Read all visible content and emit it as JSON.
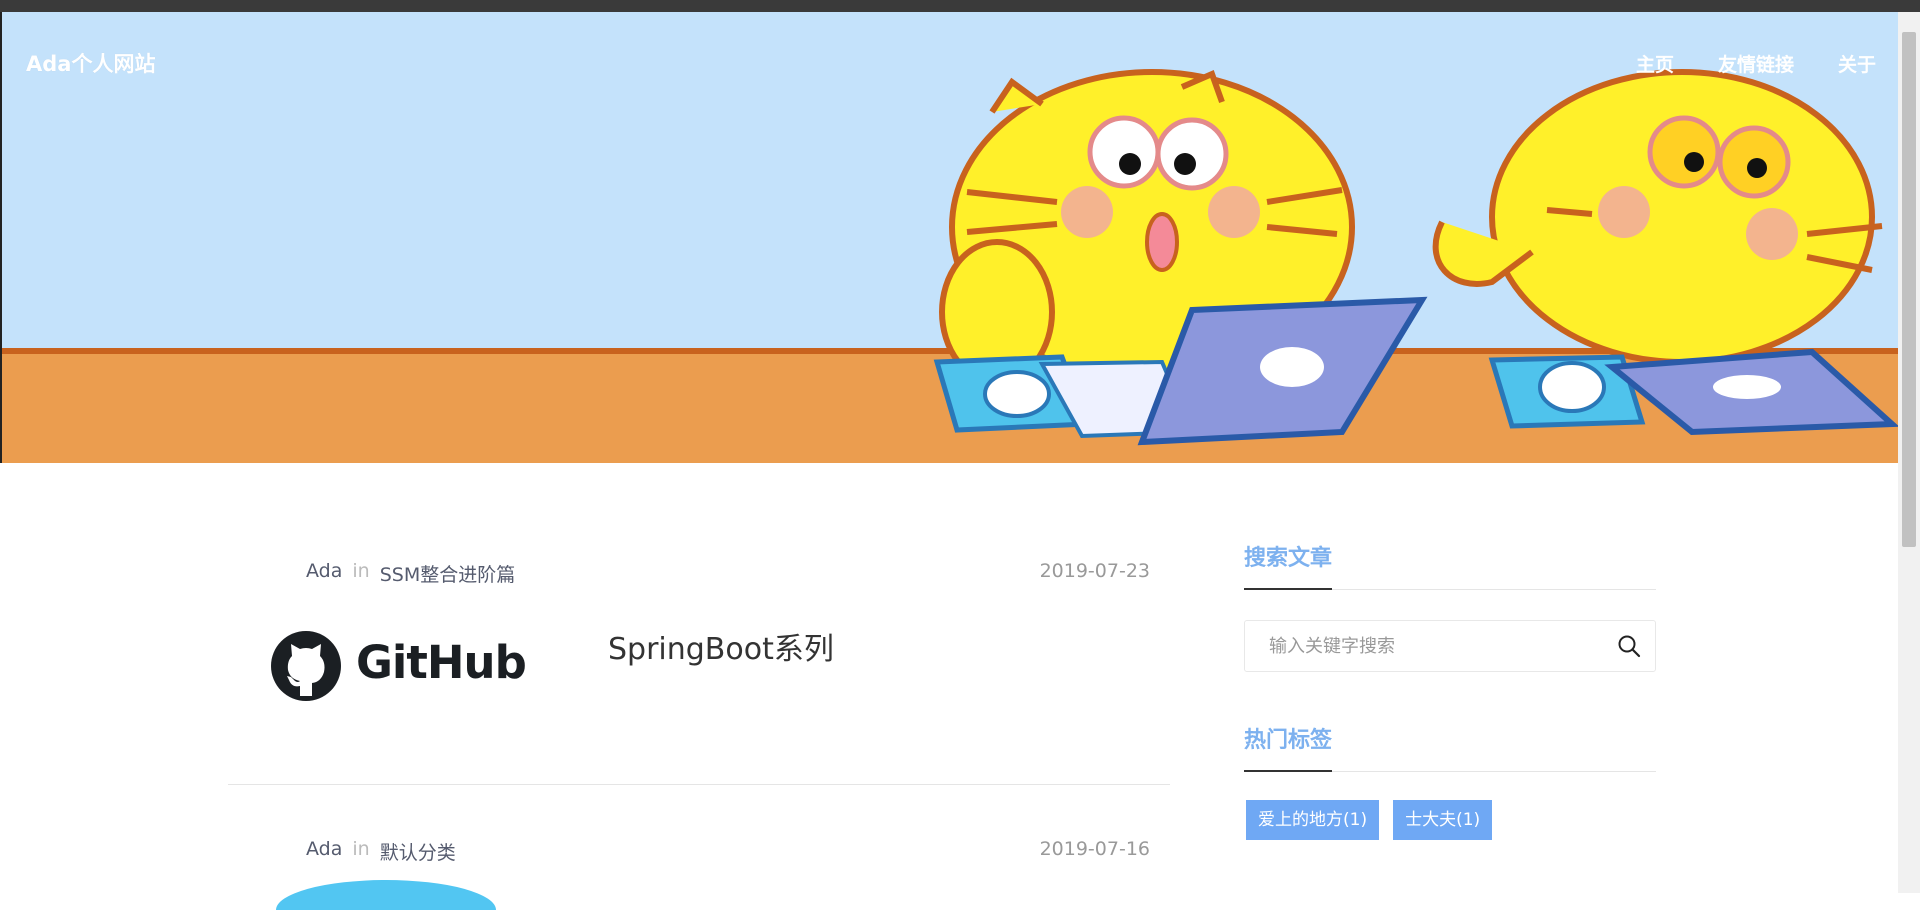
{
  "header": {
    "site_title": "Ada个人网站",
    "nav": [
      {
        "label": "主页"
      },
      {
        "label": "友情链接"
      },
      {
        "label": "关于"
      }
    ]
  },
  "posts": [
    {
      "author": "Ada",
      "in_label": "in",
      "category": "SSM整合进阶篇",
      "date": "2019-07-23",
      "thumbnail_text": "GitHub",
      "title": "SpringBoot系列"
    },
    {
      "author": "Ada",
      "in_label": "in",
      "category": "默认分类",
      "date": "2019-07-16"
    }
  ],
  "sidebar": {
    "search": {
      "title": "搜索文章",
      "placeholder": "输入关键字搜索",
      "icon": "search-icon"
    },
    "tags": {
      "title": "热门标签",
      "items": [
        {
          "label": "爱上的地方(1)"
        },
        {
          "label": "士大夫(1)"
        }
      ]
    }
  },
  "colors": {
    "hero_sky": "#c4e2fb",
    "hero_desk": "#eb9d4f",
    "accent": "#7db1ef",
    "tag_bg": "#6fa8f4"
  }
}
